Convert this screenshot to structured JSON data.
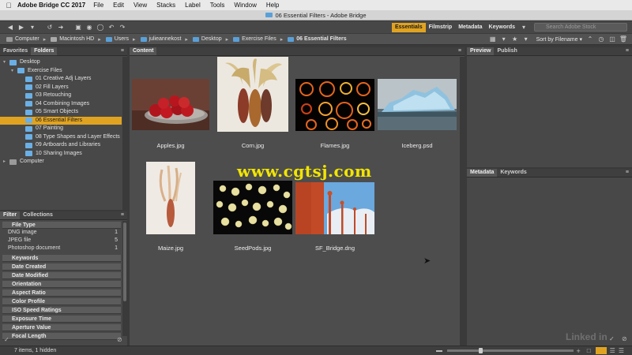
{
  "menubar": {
    "app_name": "Adobe Bridge CC 2017",
    "items": [
      "File",
      "Edit",
      "View",
      "Stacks",
      "Label",
      "Tools",
      "Window",
      "Help"
    ]
  },
  "window": {
    "title": "06 Essential Filters - Adobe Bridge"
  },
  "toolbar": {
    "workspaces": [
      "Essentials",
      "Filmstrip",
      "Metadata",
      "Keywords"
    ],
    "active_workspace": "Essentials",
    "search_placeholder": "Search Adobe Stock"
  },
  "path": [
    "Computer",
    "Macintosh HD",
    "Users",
    "julieannekost",
    "Desktop",
    "Exercise Files",
    "06 Essential Filters"
  ],
  "sort": {
    "label": "Sort by Filename"
  },
  "left_top": {
    "tabs": [
      "Favorites",
      "Folders"
    ],
    "active_tab": "Folders",
    "tree": [
      {
        "label": "Desktop",
        "level": 0
      },
      {
        "label": "Exercise Files",
        "level": 1
      },
      {
        "label": "01 Creative Adj Layers",
        "level": 2
      },
      {
        "label": "02 Fill Layers",
        "level": 2
      },
      {
        "label": "03 Retouching",
        "level": 2
      },
      {
        "label": "04 Combining Images",
        "level": 2
      },
      {
        "label": "05 Smart Objects",
        "level": 2
      },
      {
        "label": "06 Essential Filters",
        "level": 2,
        "selected": true
      },
      {
        "label": "07 Painting",
        "level": 2
      },
      {
        "label": "08 Type Shapes and Layer Effects",
        "level": 2
      },
      {
        "label": "09 Artboards and Libraries",
        "level": 2
      },
      {
        "label": "10 Sharing Images",
        "level": 2
      },
      {
        "label": "Computer",
        "level": 0
      }
    ]
  },
  "left_bottom": {
    "tabs": [
      "Filter",
      "Collections"
    ],
    "active_tab": "Filter",
    "file_type_header": "File Type",
    "file_types": [
      {
        "label": "DNG image",
        "count": "1"
      },
      {
        "label": "JPEG file",
        "count": "5"
      },
      {
        "label": "Photoshop document",
        "count": "1"
      }
    ],
    "groups": [
      "Keywords",
      "Date Created",
      "Date Modified",
      "Orientation",
      "Aspect Ratio",
      "Color Profile",
      "ISO Speed Ratings",
      "Exposure Time",
      "Aperture Value",
      "Focal Length"
    ]
  },
  "content": {
    "tab": "Content",
    "items": [
      {
        "name": "Apples.jpg"
      },
      {
        "name": "Corn.jpg"
      },
      {
        "name": "Flames.jpg"
      },
      {
        "name": "Iceberg.psd"
      },
      {
        "name": "Maize.jpg"
      },
      {
        "name": "SeedPods.jpg"
      },
      {
        "name": "SF_Bridge.dng"
      }
    ]
  },
  "preview": {
    "tabs": [
      "Preview",
      "Publish"
    ],
    "active_tab": "Preview"
  },
  "metadata": {
    "tabs": [
      "Metadata",
      "Keywords"
    ],
    "active_tab": "Metadata"
  },
  "status": {
    "text": "7 items, 1 hidden"
  },
  "watermark": {
    "text": "www.cgtsj.com"
  },
  "logo_text": "Linked in",
  "colors": {
    "accent": "#e0a321",
    "folder": "#6ab0e6"
  }
}
